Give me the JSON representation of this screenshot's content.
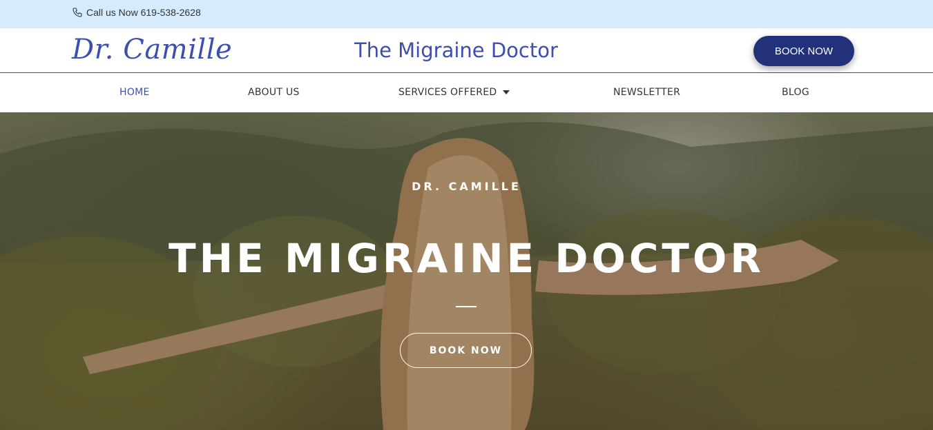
{
  "topbar": {
    "phone_text": "Call us Now 619-538-2628",
    "icon": "phone-icon"
  },
  "header": {
    "logo": "Dr. Camille",
    "site_title": "The Migraine Doctor",
    "book_button": "BOOK NOW"
  },
  "nav": {
    "items": [
      {
        "label": "HOME",
        "active": true
      },
      {
        "label": "ABOUT US"
      },
      {
        "label": "SERVICES OFFERED",
        "has_dropdown": true
      },
      {
        "label": "NEWSLETTER"
      },
      {
        "label": "BLOG"
      }
    ]
  },
  "hero": {
    "subtitle": "DR. CAMILLE",
    "headline": "THE MIGRAINE DOCTOR",
    "button": "BOOK NOW"
  },
  "colors": {
    "brand": "#3d4fae",
    "button_dark": "#23307a",
    "topbar_bg": "#d6ecfd"
  }
}
